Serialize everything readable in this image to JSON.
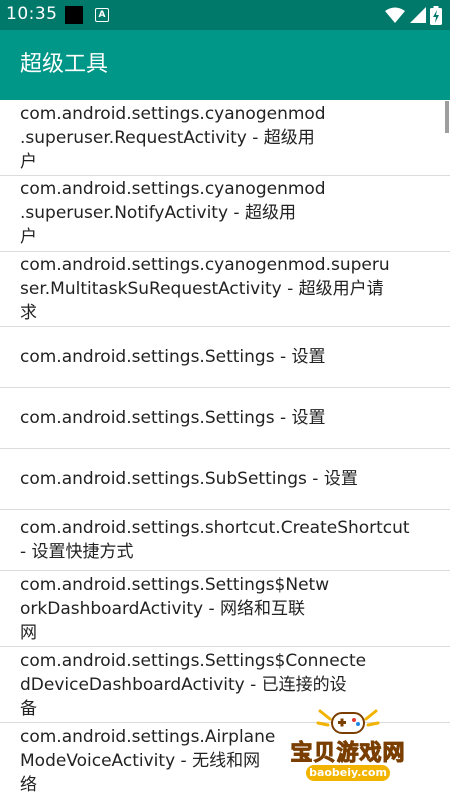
{
  "status_bar": {
    "time": "10:35",
    "notification_badge": "A"
  },
  "app_bar": {
    "title": "超级工具"
  },
  "activities": [
    "com.android.settings.cyanogenmod\n.superuser.RequestActivity - 超级用\n户",
    "com.android.settings.cyanogenmod\n.superuser.NotifyActivity - 超级用\n户",
    "com.android.settings.cyanogenmod.superu\nser.MultitaskSuRequestActivity - 超级用户请\n求",
    "com.android.settings.Settings - 设置",
    "com.android.settings.Settings - 设置",
    "com.android.settings.SubSettings - 设置",
    "com.android.settings.shortcut.CreateShortcut\n- 设置快捷方式",
    "com.android.settings.Settings$Netw\norkDashboardActivity - 网络和互联\n网",
    "com.android.settings.Settings$Connecte\ndDeviceDashboardActivity - 已连接的设\n备",
    "com.android.settings.Airplane\nModeVoiceActivity - 无线和网\n络"
  ],
  "watermark": {
    "name": "宝贝游戏网",
    "url": "baobeiy.com"
  },
  "colors": {
    "status_bar": "#00796b",
    "app_bar": "#009688",
    "divider": "#dcdcdc"
  }
}
